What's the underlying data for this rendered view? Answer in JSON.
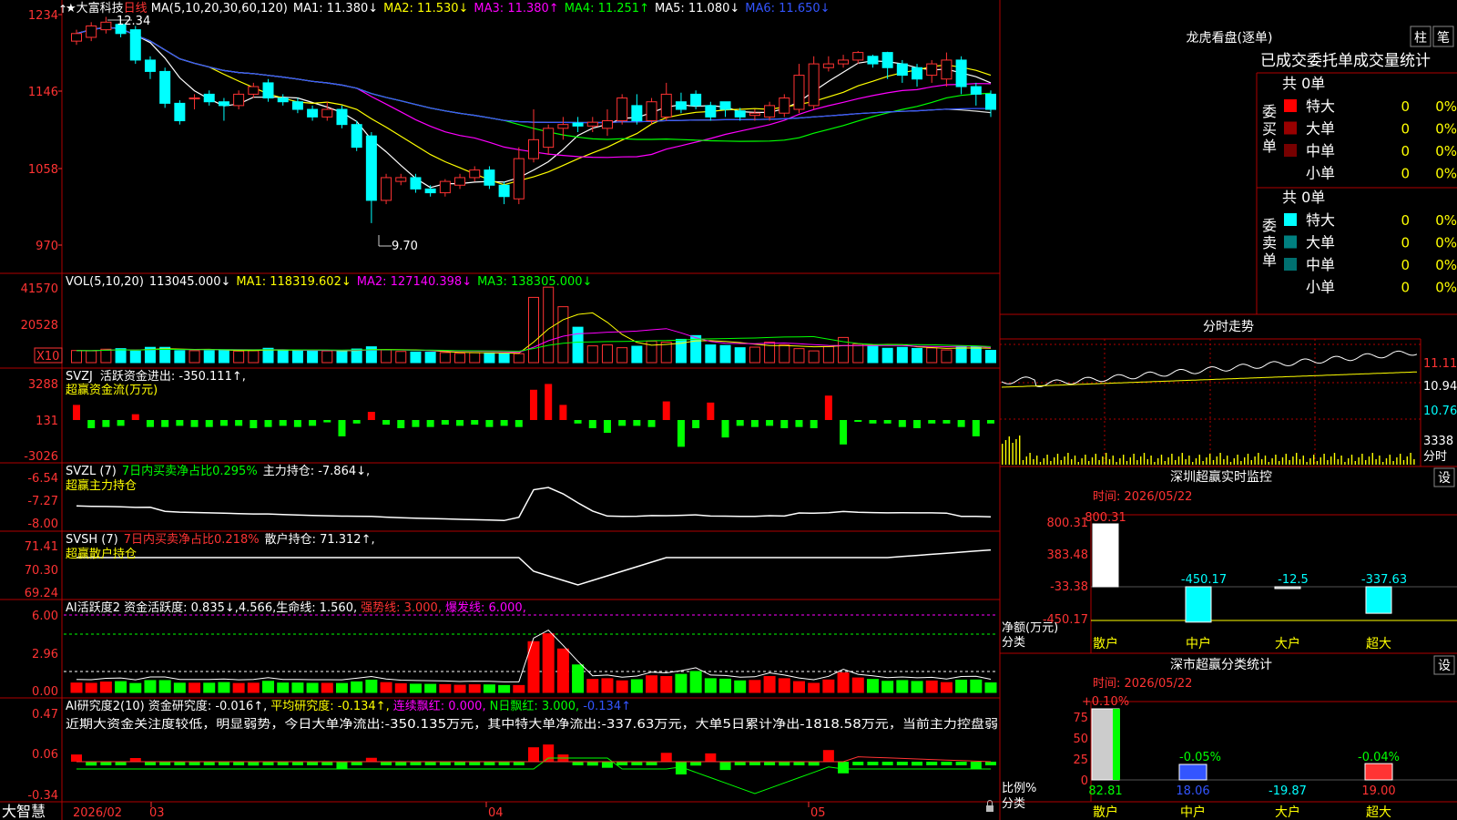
{
  "stock": {
    "name": "大富科技",
    "period": "日线"
  },
  "main_panel": {
    "ma_header": "MA(5,10,20,30,60,120)",
    "ma_values": [
      {
        "label": "MA1: 11.380↓",
        "color": "#ffffff"
      },
      {
        "label": "MA2: 11.530↓",
        "color": "#ffff00"
      },
      {
        "label": "MA3: 11.380↑",
        "color": "#ff00ff"
      },
      {
        "label": "MA4: 11.251↑",
        "color": "#00ff00"
      },
      {
        "label": "MA5: 11.080↓",
        "color": "#ffffff"
      },
      {
        "label": "MA6: 11.650↓",
        "color": "#3355ff"
      }
    ],
    "high_label": "12.34",
    "low_label": "9.70"
  },
  "vol_panel": {
    "header": "VOL(5,10,20)",
    "value": "113045.000↓",
    "mas": [
      {
        "label": "MA1: 118319.602↓",
        "color": "#ffff00"
      },
      {
        "label": "MA2: 127140.398↓",
        "color": "#ff00ff"
      },
      {
        "label": "MA3: 138305.000↓",
        "color": "#00ff00"
      }
    ],
    "unit": "X10"
  },
  "svzj_panel": {
    "title": "SVZJ",
    "label": "活跃资金进出: -350.111↑,",
    "sub": "超赢资金流(万元)"
  },
  "svzl_panel": {
    "title": "SVZL (7)",
    "label1": "7日内买卖净占比0.295%",
    "label2": "主力持仓: -7.864↓,",
    "sub": "超赢主力持仓"
  },
  "svsh_panel": {
    "title": "SVSH (7)",
    "label1": "7日内买卖净占比0.218%",
    "label2": "散户持仓: 71.312↑,",
    "sub": "超赢散户持仓"
  },
  "ai_active_panel": {
    "label": "AI活跃度2 资金活跃度: 0.835↓,4.566,生命线: 1.560,",
    "strong": "强势线: 3.000,",
    "burst": "爆发线: 6.000,"
  },
  "ai_research_panel": {
    "label": "AI研究度2(10) 资金研究度: -0.016↑,",
    "avg": "平均研究度: -0.134↑,",
    "red": "连续飘红: 0.000,",
    "nred": "N日飘红: 3.000,",
    "last": "-0.134↑",
    "commentary": "近期大资金关注度较低，明显弱势，今日大单净流出:-350.135万元，其中特大单净流出:-337.63万元，大单5日累计净出-1818.58万元，当前主力控盘弱"
  },
  "bottom": {
    "brand": "大智慧",
    "date_label": "2026/02",
    "months": [
      "03",
      "04",
      "05"
    ]
  },
  "longhu": {
    "title": "龙虎看盘(逐单)",
    "btn1": "柱",
    "btn2": "笔",
    "subtitle": "已成交委托单成交量统计",
    "buy_side": "委买单",
    "sell_side": "委卖单",
    "total_buy": "共 0单",
    "total_sell": "共 0单",
    "buy_rows": [
      {
        "name": "特大",
        "count": "0",
        "pct": "0%",
        "color": "#ff0000"
      },
      {
        "name": "大单",
        "count": "0",
        "pct": "0%",
        "color": "#990000"
      },
      {
        "name": "中单",
        "count": "0",
        "pct": "0%",
        "color": "#770000"
      },
      {
        "name": "小单",
        "count": "0",
        "pct": "0%",
        "color": "#000000"
      }
    ],
    "sell_rows": [
      {
        "name": "特大",
        "count": "0",
        "pct": "0%",
        "color": "#00ffff"
      },
      {
        "name": "大单",
        "count": "0",
        "pct": "0%",
        "color": "#008080"
      },
      {
        "name": "中单",
        "count": "0",
        "pct": "0%",
        "color": "#007070"
      },
      {
        "name": "小单",
        "count": "0",
        "pct": "0%",
        "color": "#000000"
      }
    ]
  },
  "intraday": {
    "title": "分时走势",
    "labels": [
      "11.11",
      "10.94",
      "10.76"
    ],
    "vol_label": "3338",
    "vol_unit": "分时"
  },
  "monitor": {
    "title": "深圳超赢实时监控",
    "btn": "设",
    "time_label": "时间: 2026/05/22",
    "ylabel": "净额(万元)",
    "xlabel": "分类",
    "values": [
      "800.31",
      "-450.17",
      "-12.5",
      "-337.63"
    ]
  },
  "stats": {
    "title": "深市超赢分类统计",
    "btn": "设",
    "time_label": "时间: 2026/05/22",
    "ylabel": "比例%",
    "xlabel": "分类",
    "top_labels": [
      "+0.10%",
      "-0.05%",
      "-0.04%"
    ],
    "bottom_labels": [
      "82.81",
      "18.06",
      "-19.87",
      "19.00"
    ]
  },
  "chart_data": [
    {
      "type": "candlestick",
      "title": "大富科技 日线",
      "y_ticks": [
        "1234",
        "1146",
        "1058",
        "970"
      ],
      "ylim": [
        9.35,
        12.45
      ],
      "open": [
        12.1,
        12.15,
        12.25,
        12.32,
        12.25,
        11.85,
        11.7,
        11.28,
        11.35,
        11.4,
        11.3,
        11.25,
        11.4,
        11.55,
        11.35,
        11.3,
        11.2,
        11.1,
        11.2,
        11.0,
        10.85,
        10.0,
        10.25,
        10.3,
        10.15,
        10.1,
        10.2,
        10.3,
        10.4,
        10.2,
        10.02,
        10.55,
        10.7,
        10.95,
        11.02,
        10.98,
        10.95,
        11.05,
        11.25,
        11.05,
        11.1,
        11.3,
        11.4,
        11.25,
        11.3,
        11.18,
        11.12,
        11.1,
        11.15,
        11.2,
        11.25,
        11.75,
        11.8,
        11.85,
        11.9,
        11.95,
        11.8,
        11.75,
        11.65,
        11.6,
        11.85,
        11.5,
        11.4
      ],
      "close": [
        12.2,
        12.3,
        12.35,
        12.2,
        11.85,
        11.7,
        11.28,
        11.05,
        11.35,
        11.3,
        11.25,
        11.4,
        11.5,
        11.35,
        11.3,
        11.2,
        11.1,
        11.2,
        11.0,
        10.7,
        10.0,
        10.3,
        10.3,
        10.15,
        10.1,
        10.25,
        10.3,
        10.4,
        10.2,
        10.05,
        10.55,
        10.8,
        10.95,
        11.0,
        10.98,
        11.03,
        11.05,
        11.35,
        11.05,
        11.3,
        11.4,
        11.2,
        11.25,
        11.1,
        11.2,
        11.1,
        11.15,
        11.25,
        11.35,
        11.65,
        11.8,
        11.8,
        11.85,
        11.95,
        11.8,
        11.75,
        11.65,
        11.6,
        11.8,
        11.85,
        11.5,
        11.4,
        11.2
      ],
      "high": [
        12.25,
        12.35,
        12.42,
        12.34,
        12.3,
        11.9,
        11.75,
        11.32,
        11.4,
        11.45,
        11.35,
        11.45,
        11.55,
        11.6,
        11.4,
        11.35,
        11.25,
        11.3,
        11.25,
        11.05,
        10.9,
        10.35,
        10.35,
        10.35,
        10.2,
        10.28,
        10.35,
        10.45,
        10.45,
        10.25,
        10.7,
        11.2,
        11.0,
        11.1,
        11.1,
        11.1,
        11.2,
        11.4,
        11.4,
        11.35,
        11.55,
        11.42,
        11.45,
        11.3,
        11.25,
        11.22,
        11.2,
        11.3,
        11.4,
        11.8,
        11.9,
        11.9,
        11.92,
        11.97,
        11.92,
        11.96,
        11.85,
        11.8,
        11.85,
        11.95,
        11.9,
        11.55,
        11.45
      ],
      "low": [
        12.05,
        12.1,
        12.2,
        12.15,
        11.8,
        11.6,
        11.22,
        11.0,
        11.2,
        11.25,
        11.05,
        11.2,
        11.35,
        11.3,
        11.25,
        11.15,
        11.05,
        11.05,
        10.95,
        10.65,
        9.7,
        9.95,
        10.2,
        10.1,
        10.05,
        10.05,
        10.15,
        10.25,
        10.15,
        9.95,
        9.95,
        10.5,
        10.6,
        10.8,
        10.9,
        10.9,
        10.85,
        11.0,
        11.0,
        11.0,
        11.05,
        11.15,
        11.2,
        11.05,
        11.1,
        11.05,
        11.05,
        11.05,
        11.1,
        11.15,
        11.2,
        11.7,
        11.75,
        11.8,
        11.75,
        11.6,
        11.55,
        11.5,
        11.55,
        11.5,
        11.4,
        11.25,
        11.1
      ]
    },
    {
      "type": "bar",
      "title": "VOL(5,10,20)",
      "y_ticks": [
        "41570",
        "20528"
      ],
      "ylim": [
        0,
        44000
      ],
      "values": [
        6500,
        6300,
        7200,
        7500,
        6200,
        8200,
        8200,
        6400,
        6400,
        6400,
        6800,
        6200,
        6400,
        7700,
        6500,
        6500,
        6300,
        6300,
        6200,
        7300,
        8500,
        6800,
        6000,
        5700,
        5600,
        5400,
        5000,
        5300,
        5200,
        4800,
        4800,
        35000,
        40500,
        30000,
        19000,
        9000,
        9500,
        8000,
        8800,
        11500,
        11000,
        12500,
        14500,
        9500,
        9200,
        8000,
        8300,
        11000,
        9500,
        7500,
        6300,
        8600,
        13500,
        10000,
        9000,
        7700,
        8200,
        7600,
        7900,
        6800,
        8500,
        8600,
        6600
      ]
    },
    {
      "type": "bar",
      "title": "SVZJ",
      "y_ticks": [
        "3288",
        "131",
        "-3026"
      ],
      "ylim": [
        -3026,
        3288
      ],
      "values": [
        1300,
        -700,
        -600,
        -500,
        500,
        -600,
        -600,
        -500,
        -600,
        -600,
        -500,
        -500,
        -700,
        -600,
        -500,
        -600,
        -500,
        -200,
        -1400,
        -300,
        700,
        -400,
        -700,
        -600,
        -600,
        -400,
        -500,
        -400,
        -600,
        -500,
        -600,
        2600,
        3100,
        1300,
        -300,
        -700,
        -1100,
        -500,
        -500,
        -600,
        1600,
        -2300,
        -700,
        1500,
        -1500,
        -500,
        -600,
        -500,
        -700,
        -600,
        -700,
        2100,
        -2100,
        -100,
        -300,
        -300,
        -600,
        -700,
        -300,
        -300,
        -600,
        -1400,
        -300
      ]
    }
  ]
}
